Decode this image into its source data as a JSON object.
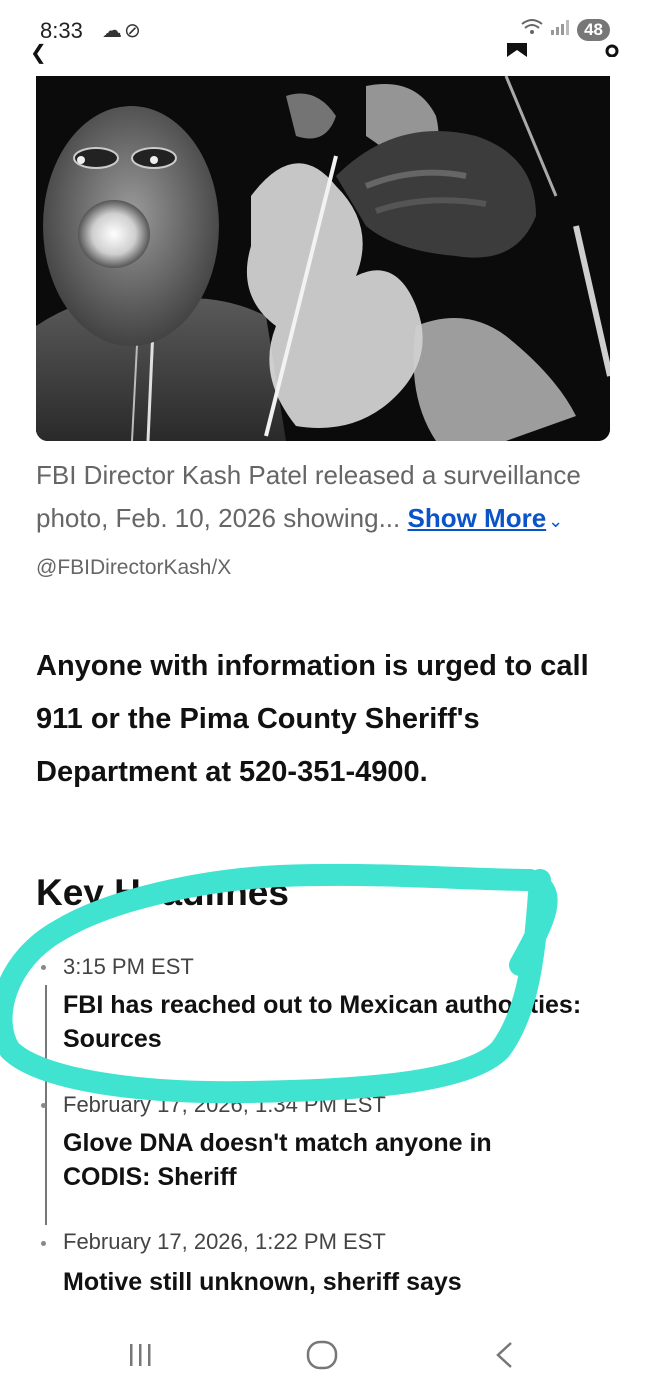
{
  "status_bar": {
    "time": "8:33",
    "left_icons": [
      "cloud-icon",
      "no-signal-icon"
    ],
    "battery": "48"
  },
  "article": {
    "photo_caption_text": "FBI Director Kash Patel released a surveillance photo, Feb. 10, 2026 showing...",
    "show_more_label": "Show More",
    "photo_credit": "@FBIDirectorKash/X",
    "callout": "Anyone with information is urged to call 911 or the Pima County Sheriff's Department at 520-351-4900."
  },
  "key_headlines": {
    "heading": "Key Headlines",
    "items": [
      {
        "time": "3:15 PM EST",
        "headline": "FBI has reached out to Mexican authorities: Sources"
      },
      {
        "time": "February 17, 2026, 1:34 PM EST",
        "headline": "Glove DNA doesn't match anyone in CODIS: Sheriff"
      },
      {
        "time": "February 17, 2026, 1:22 PM EST",
        "headline": "Motive still unknown, sheriff says"
      }
    ]
  },
  "annotation_color": "#3fe3cf",
  "link_color": "#0a53c9"
}
